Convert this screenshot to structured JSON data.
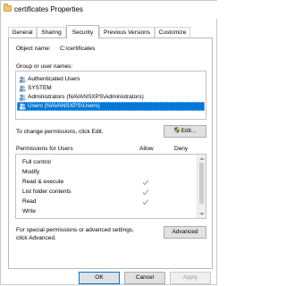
{
  "window": {
    "title": "certificates Properties"
  },
  "tabs": [
    {
      "label": "General"
    },
    {
      "label": "Sharing"
    },
    {
      "label": "Security",
      "active": true
    },
    {
      "label": "Previous Versions"
    },
    {
      "label": "Customize"
    }
  ],
  "object": {
    "label": "Object name:",
    "value": "C:\\certificates"
  },
  "groups": {
    "label": "Group or user names:",
    "items": [
      {
        "label": "Authenticated Users"
      },
      {
        "label": "SYSTEM"
      },
      {
        "label": "Administrators (NAVANSXPS\\Administrators)"
      },
      {
        "label": "Users (NAVANSXPS\\Users)",
        "selected": true
      }
    ]
  },
  "change_permissions": {
    "text": "To change permissions, click Edit.",
    "button": "Edit..."
  },
  "permissions": {
    "header": "Permissions for Users",
    "allow_label": "Allow",
    "deny_label": "Deny",
    "rows": [
      {
        "name": "Full control",
        "allow": false,
        "deny": false
      },
      {
        "name": "Modify",
        "allow": false,
        "deny": false
      },
      {
        "name": "Read & execute",
        "allow": true,
        "deny": false
      },
      {
        "name": "List folder contents",
        "allow": true,
        "deny": false
      },
      {
        "name": "Read",
        "allow": true,
        "deny": false
      },
      {
        "name": "Write",
        "allow": false,
        "deny": false
      }
    ]
  },
  "advanced": {
    "text_line1": "For special permissions or advanced settings,",
    "text_line2": "click Advanced.",
    "button": "Advanced"
  },
  "footer": {
    "ok": "OK",
    "cancel": "Cancel",
    "apply": "Apply"
  },
  "colors": {
    "selection": "#0078d7",
    "button_face": "#e1e1e1",
    "check_gray": "#8e8e8e"
  }
}
